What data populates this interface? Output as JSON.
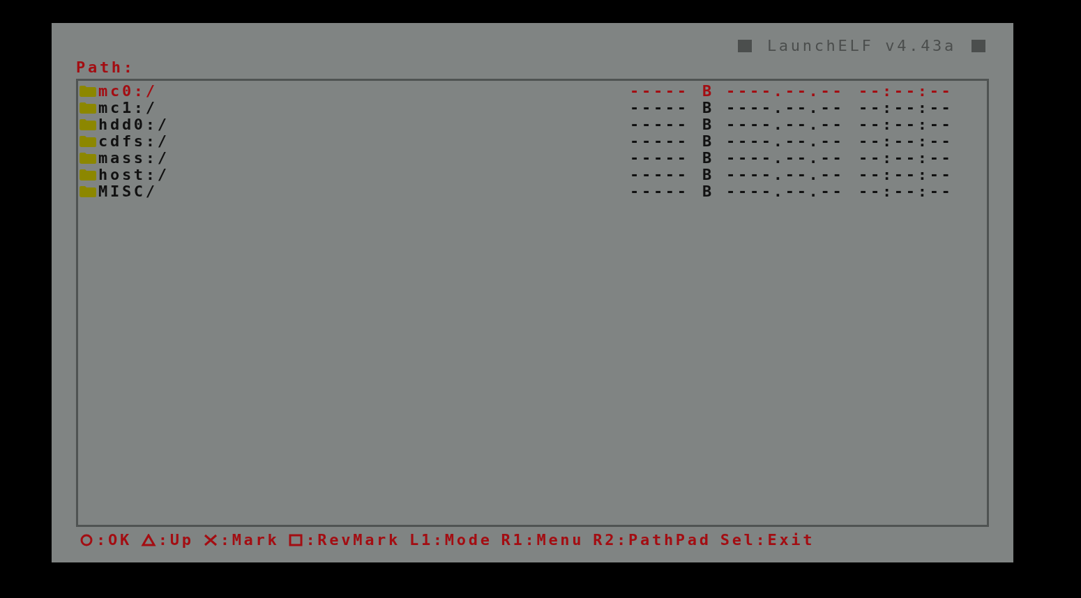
{
  "window": {
    "title": "LaunchELF v4.43a"
  },
  "path_label": "Path:",
  "files": [
    {
      "name": "mc0:/",
      "size": "-----",
      "unit": "B",
      "date": "----.--.--",
      "time": "--:--:--",
      "selected": true
    },
    {
      "name": "mc1:/",
      "size": "-----",
      "unit": "B",
      "date": "----.--.--",
      "time": "--:--:--",
      "selected": false
    },
    {
      "name": "hdd0:/",
      "size": "-----",
      "unit": "B",
      "date": "----.--.--",
      "time": "--:--:--",
      "selected": false
    },
    {
      "name": "cdfs:/",
      "size": "-----",
      "unit": "B",
      "date": "----.--.--",
      "time": "--:--:--",
      "selected": false
    },
    {
      "name": "mass:/",
      "size": "-----",
      "unit": "B",
      "date": "----.--.--",
      "time": "--:--:--",
      "selected": false
    },
    {
      "name": "host:/",
      "size": "-----",
      "unit": "B",
      "date": "----.--.--",
      "time": "--:--:--",
      "selected": false
    },
    {
      "name": "MISC/",
      "size": "-----",
      "unit": "B",
      "date": "----.--.--",
      "time": "--:--:--",
      "selected": false
    }
  ],
  "hints": [
    {
      "kind": "circle",
      "label": ":OK"
    },
    {
      "kind": "triangle",
      "label": ":Up"
    },
    {
      "kind": "cross",
      "label": ":Mark"
    },
    {
      "kind": "square",
      "label": ":RevMark"
    },
    {
      "kind": "text",
      "label": "L1:Mode"
    },
    {
      "kind": "text",
      "label": "R1:Menu"
    },
    {
      "kind": "text",
      "label": "R2:PathPad"
    },
    {
      "kind": "text",
      "label": "Sel:Exit"
    }
  ]
}
